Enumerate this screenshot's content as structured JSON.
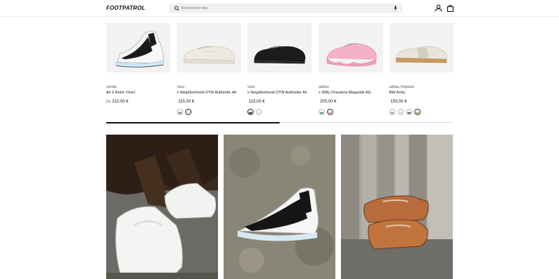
{
  "header": {
    "logo": "FOOTPATROL",
    "search_placeholder": "Rechercher des",
    "icons": [
      "search-icon",
      "microphone-icon",
      "account-icon",
      "cart-icon"
    ]
  },
  "products": [
    {
      "brand": "Jordan",
      "name": "Air 6 Retro 'Oreo'",
      "price_prefix": "De",
      "price": "210,00 €",
      "swatch_count": 0
    },
    {
      "brand": "Vans",
      "name": "x Neighborhood OTW Authentic 44",
      "price_prefix": "",
      "price": "115,00 €",
      "swatch_count": 2
    },
    {
      "brand": "Vans",
      "name": "x Neighborhood OTW Authentic 44",
      "price_prefix": "",
      "price": "115,00 €",
      "swatch_count": 2
    },
    {
      "brand": "adidas",
      "name": "x WBy Chavarria Megaride AG",
      "price_prefix": "",
      "price": "200,00 €",
      "swatch_count": 2
    },
    {
      "brand": "adidas Originals",
      "name": "BW Army",
      "price_prefix": "",
      "price": "150,00 €",
      "swatch_count": 4
    }
  ],
  "carousel": {
    "progress": 0.5
  },
  "colors": {
    "accent": "#111111",
    "background": "#ffffff",
    "card_bg": "#f2f2f2"
  }
}
